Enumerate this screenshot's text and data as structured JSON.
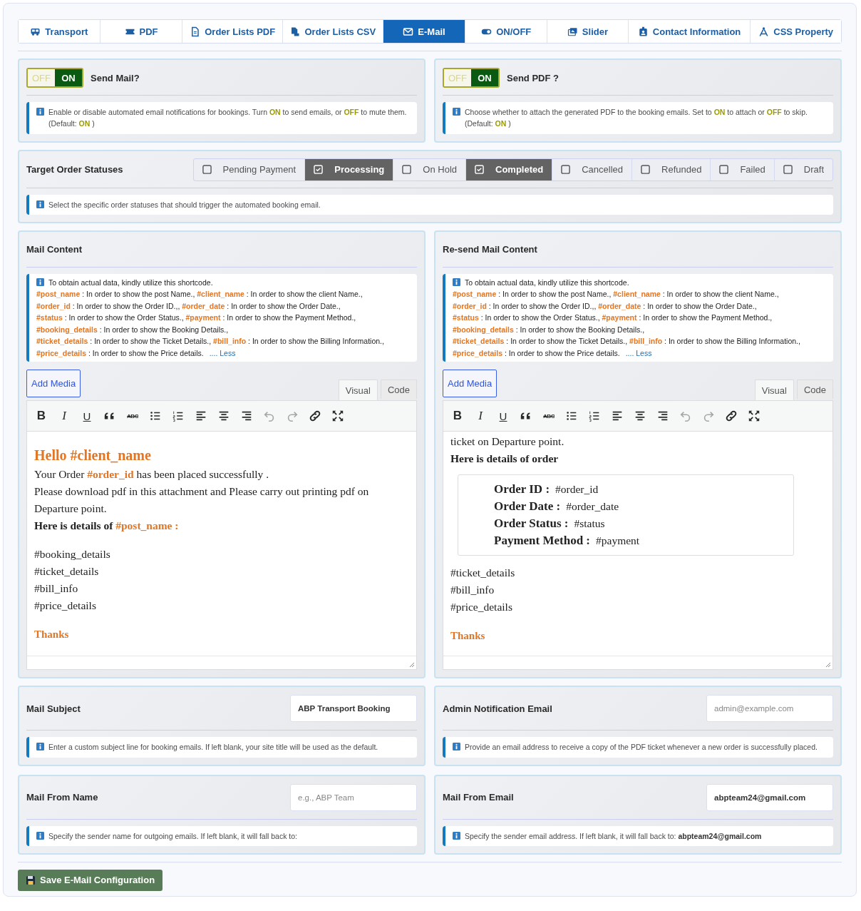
{
  "tabs": [
    {
      "label": "Transport",
      "selected": false
    },
    {
      "label": "PDF",
      "selected": false
    },
    {
      "label": "Order Lists PDF",
      "selected": false
    },
    {
      "label": "Order Lists CSV",
      "selected": false
    },
    {
      "label": "E-Mail",
      "selected": true
    },
    {
      "label": "ON/OFF",
      "selected": false
    },
    {
      "label": "Slider",
      "selected": false
    },
    {
      "label": "Contact Information",
      "selected": false
    },
    {
      "label": "CSS Property",
      "selected": false
    }
  ],
  "toggles": [
    {
      "off_label": "OFF",
      "on_label": "ON",
      "on": true,
      "title": "Send Mail?",
      "note": [
        {
          "text": "Enable or disable automated email notifications for bookings. Turn ",
          "kind": "text"
        },
        {
          "text": "ON",
          "kind": "flag"
        },
        {
          "text": " to send emails, or ",
          "kind": "text"
        },
        {
          "text": "OFF",
          "kind": "flag"
        },
        {
          "text": " to mute them. (Default: ",
          "kind": "text"
        },
        {
          "text": "ON",
          "kind": "flag"
        },
        {
          "text": " )",
          "kind": "text"
        }
      ]
    },
    {
      "off_label": "OFF",
      "on_label": "ON",
      "on": true,
      "title": "Send PDF ?",
      "note": [
        {
          "text": "Choose whether to attach the generated PDF to the booking emails. Set to ",
          "kind": "text"
        },
        {
          "text": "ON",
          "kind": "flag"
        },
        {
          "text": " to attach or ",
          "kind": "text"
        },
        {
          "text": "OFF",
          "kind": "flag"
        },
        {
          "text": " to skip. (Default: ",
          "kind": "text"
        },
        {
          "text": "ON",
          "kind": "flag"
        },
        {
          "text": " )",
          "kind": "text"
        }
      ]
    }
  ],
  "statuses": {
    "title": "Target Order Statuses",
    "options": [
      {
        "label": "Pending Payment",
        "checked": false
      },
      {
        "label": "Processing",
        "checked": true
      },
      {
        "label": "On Hold",
        "checked": false
      },
      {
        "label": "Completed",
        "checked": true
      },
      {
        "label": "Cancelled",
        "checked": false
      },
      {
        "label": "Refunded",
        "checked": false
      },
      {
        "label": "Failed",
        "checked": false
      },
      {
        "label": "Draft",
        "checked": false
      }
    ],
    "note": [
      {
        "text": "Select the specific order statuses that should trigger the automated booking email.",
        "kind": "text"
      }
    ]
  },
  "editors": [
    {
      "title": "Mail Content",
      "help": {
        "intro": "To obtain actual data, kindly utilize this shortcode.",
        "lines": [
          [
            {
              "text": "#post_name",
              "code": true
            },
            {
              "text": " : In order to show the post Name., ",
              "code": false
            },
            {
              "text": "#client_name",
              "code": true
            },
            {
              "text": " : In order to show the client Name.,",
              "code": false
            }
          ],
          [
            {
              "text": "#order_id",
              "code": true
            },
            {
              "text": " : In order to show the Order ID.,, ",
              "code": false
            },
            {
              "text": "#order_date",
              "code": true
            },
            {
              "text": " : In order to show the Order Date.,",
              "code": false
            }
          ],
          [
            {
              "text": "#status",
              "code": true
            },
            {
              "text": " : In order to show the Order Status., ",
              "code": false
            },
            {
              "text": "#payment",
              "code": true
            },
            {
              "text": " : In order to show the Payment Method.,",
              "code": false
            }
          ],
          [
            {
              "text": "#booking_details",
              "code": true
            },
            {
              "text": " : In order to show the Booking Details.,",
              "code": false
            }
          ],
          [
            {
              "text": "#ticket_details",
              "code": true
            },
            {
              "text": " : In order to show the Ticket Details., ",
              "code": false
            },
            {
              "text": "#bill_info",
              "code": true
            },
            {
              "text": " : In order to show the Billing Information.,",
              "code": false
            }
          ],
          [
            {
              "text": "#price_details",
              "code": true
            },
            {
              "text": " : In order to show the Price details.",
              "code": false
            }
          ]
        ],
        "less": ".... Less"
      },
      "add_media": "Add Media",
      "modes": [
        {
          "label": "Visual",
          "selected": true
        },
        {
          "label": "Code",
          "selected": false
        }
      ],
      "toolbar": [
        {
          "kind": "bold",
          "glyph": "B",
          "disabled": false
        },
        {
          "kind": "italic",
          "glyph": "I",
          "disabled": false
        },
        {
          "kind": "underline",
          "glyph": "U",
          "disabled": false
        },
        {
          "kind": "blockquote",
          "disabled": false
        },
        {
          "kind": "strikethrough",
          "glyph": "ABC",
          "disabled": false
        },
        {
          "kind": "bulleted_list",
          "disabled": false
        },
        {
          "kind": "numbered_list",
          "disabled": false
        },
        {
          "kind": "align_left",
          "disabled": false
        },
        {
          "kind": "align_center",
          "disabled": false
        },
        {
          "kind": "align_right",
          "disabled": false
        },
        {
          "kind": "undo",
          "disabled": true
        },
        {
          "kind": "redo",
          "disabled": true
        },
        {
          "kind": "link",
          "disabled": false
        },
        {
          "kind": "fullscreen",
          "disabled": false
        }
      ],
      "body": [
        {
          "kind": "gap"
        },
        {
          "kind": "heading",
          "parts": [
            {
              "text": "Hello #client_name",
              "code": true
            }
          ]
        },
        {
          "kind": "line",
          "parts": [
            {
              "text": "Your Order ",
              "code": false
            },
            {
              "text": "#order_id",
              "code": true
            },
            {
              "text": " has been placed successfully .",
              "code": false
            }
          ]
        },
        {
          "kind": "line",
          "parts": [
            {
              "text": "Please download pdf in this attachment and Please carry out printing pdf on Departure point.",
              "code": false
            }
          ]
        },
        {
          "kind": "bold",
          "parts": [
            {
              "text": "Here is details of ",
              "code": false
            },
            {
              "text": "#post_name :",
              "code": true
            }
          ]
        },
        {
          "kind": "gap"
        },
        {
          "kind": "line",
          "parts": [
            {
              "text": "#booking_details",
              "code": false
            }
          ]
        },
        {
          "kind": "line",
          "parts": [
            {
              "text": "#ticket_details",
              "code": false
            }
          ]
        },
        {
          "kind": "line",
          "parts": [
            {
              "text": "#bill_info",
              "code": false
            }
          ]
        },
        {
          "kind": "line",
          "parts": [
            {
              "text": "#price_details",
              "code": false
            }
          ]
        },
        {
          "kind": "gap"
        },
        {
          "kind": "thanks",
          "parts": [
            {
              "text": "Thanks",
              "code": true
            }
          ]
        }
      ]
    },
    {
      "title": "Re-send Mail Content",
      "help": {
        "intro": "To obtain actual data, kindly utilize this shortcode.",
        "lines": [
          [
            {
              "text": "#post_name",
              "code": true
            },
            {
              "text": " : In order to show the post Name., ",
              "code": false
            },
            {
              "text": "#client_name",
              "code": true
            },
            {
              "text": " : In order to show the client Name.,",
              "code": false
            }
          ],
          [
            {
              "text": "#order_id",
              "code": true
            },
            {
              "text": " : In order to show the Order ID.,, ",
              "code": false
            },
            {
              "text": "#order_date",
              "code": true
            },
            {
              "text": " : In order to show the Order Date.,",
              "code": false
            }
          ],
          [
            {
              "text": "#status",
              "code": true
            },
            {
              "text": " : In order to show the Order Status., ",
              "code": false
            },
            {
              "text": "#payment",
              "code": true
            },
            {
              "text": " : In order to show the Payment Method.,",
              "code": false
            }
          ],
          [
            {
              "text": "#booking_details",
              "code": true
            },
            {
              "text": " : In order to show the Booking Details.,",
              "code": false
            }
          ],
          [
            {
              "text": "#ticket_details",
              "code": true
            },
            {
              "text": " : In order to show the Ticket Details., ",
              "code": false
            },
            {
              "text": "#bill_info",
              "code": true
            },
            {
              "text": " : In order to show the Billing Information.,",
              "code": false
            }
          ],
          [
            {
              "text": "#price_details",
              "code": true
            },
            {
              "text": " : In order to show the Price details.",
              "code": false
            }
          ]
        ],
        "less": ".... Less"
      },
      "add_media": "Add Media",
      "modes": [
        {
          "label": "Visual",
          "selected": true
        },
        {
          "label": "Code",
          "selected": false
        }
      ],
      "toolbar": [
        {
          "kind": "bold",
          "glyph": "B",
          "disabled": false
        },
        {
          "kind": "italic",
          "glyph": "I",
          "disabled": false
        },
        {
          "kind": "underline",
          "glyph": "U",
          "disabled": false
        },
        {
          "kind": "blockquote",
          "disabled": false
        },
        {
          "kind": "strikethrough",
          "glyph": "ABC",
          "disabled": false
        },
        {
          "kind": "bulleted_list",
          "disabled": false
        },
        {
          "kind": "numbered_list",
          "disabled": false
        },
        {
          "kind": "align_left",
          "disabled": false
        },
        {
          "kind": "align_center",
          "disabled": false
        },
        {
          "kind": "align_right",
          "disabled": false
        },
        {
          "kind": "undo",
          "disabled": true
        },
        {
          "kind": "redo",
          "disabled": true
        },
        {
          "kind": "link",
          "disabled": false
        },
        {
          "kind": "fullscreen",
          "disabled": false
        }
      ],
      "body": [
        {
          "kind": "line",
          "parts": [
            {
              "text": "ticket on Departure point.",
              "code": false
            }
          ]
        },
        {
          "kind": "bold",
          "parts": [
            {
              "text": "Here is details of order",
              "code": false
            }
          ]
        },
        {
          "kind": "table",
          "rows": [
            {
              "label": "Order ID :",
              "value": "#order_id"
            },
            {
              "label": "Order Date :",
              "value": "#order_date"
            },
            {
              "label": "Order Status :",
              "value": "#status"
            },
            {
              "label": "Payment Method :",
              "value": "#payment"
            }
          ]
        },
        {
          "kind": "line",
          "parts": [
            {
              "text": "#ticket_details",
              "code": false
            }
          ]
        },
        {
          "kind": "line",
          "parts": [
            {
              "text": "#bill_info",
              "code": false
            }
          ]
        },
        {
          "kind": "line",
          "parts": [
            {
              "text": "#price_details",
              "code": false
            }
          ]
        },
        {
          "kind": "gap"
        },
        {
          "kind": "thanks",
          "parts": [
            {
              "text": "Thanks",
              "code": true
            }
          ]
        }
      ]
    }
  ],
  "fields": [
    {
      "label": "Mail Subject",
      "value": "ABP Transport Booking",
      "note": [
        {
          "text": "Enter a custom subject line for booking emails. If left blank, your site title will be used as the default.",
          "kind": "text"
        }
      ]
    },
    {
      "label": "Admin Notification Email",
      "placeholder": "admin@example.com",
      "note": [
        {
          "text": "Provide an email address to receive a copy of the PDF ticket whenever a new order is successfully placed.",
          "kind": "text"
        }
      ]
    },
    {
      "label": "Mail From Name",
      "placeholder": "e.g., ABP Team",
      "note": [
        {
          "text": "Specify the sender name for outgoing emails. If left blank, it will fall back to:",
          "kind": "text"
        }
      ]
    },
    {
      "label": "Mail From Email",
      "value": "abpteam24@gmail.com",
      "note": [
        {
          "text": "Specify the sender email address. If left blank, it will fall back to: ",
          "kind": "text"
        },
        {
          "text": "abpteam24@gmail.com",
          "kind": "strong"
        }
      ]
    }
  ],
  "save_button": "Save E-Mail Configuration"
}
